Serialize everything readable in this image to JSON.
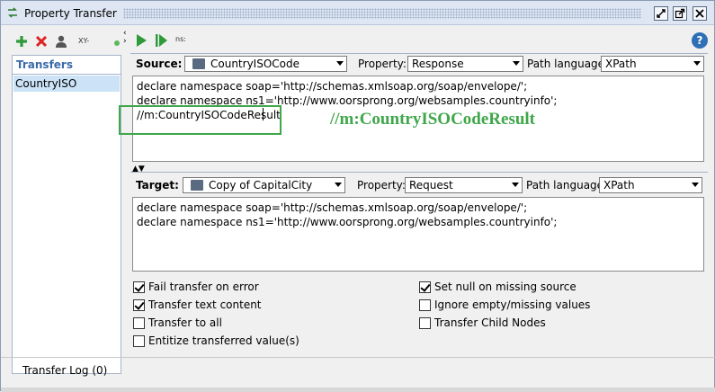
{
  "window": {
    "title": "Property Transfer",
    "buttons": [
      "restore-icon",
      "maximize-icon",
      "close-icon"
    ]
  },
  "left_toolbar": {
    "xy_label": "XY-"
  },
  "transfers": {
    "header": "Transfers",
    "items": [
      "CountryISO"
    ]
  },
  "right_toolbar": {
    "ns_label": "ns:"
  },
  "source": {
    "label": "Source:",
    "value": "CountryISOCode",
    "property_label": "Property:",
    "property_value": "Response",
    "path_language_label": "Path language:",
    "path_language_value": "XPath",
    "lines": [
      "declare namespace soap='http://schemas.xmlsoap.org/soap/envelope/';",
      "declare namespace ns1='http://www.oorsprong.org/websamples.countryinfo';",
      "//m:CountryISOCodeResult"
    ]
  },
  "annotation": "//m:CountryISOCodeResult",
  "target": {
    "label": "Target:",
    "value": "Copy of CapitalCity",
    "property_label": "Property:",
    "property_value": "Request",
    "path_language_label": "Path language:",
    "path_language_value": "XPath",
    "lines": [
      "declare namespace soap='http://schemas.xmlsoap.org/soap/envelope/';",
      "declare namespace ns1='http://www.oorsprong.org/websamples.countryinfo';"
    ]
  },
  "options": [
    {
      "label": "Fail transfer on error",
      "checked": true
    },
    {
      "label": "Transfer text content",
      "checked": true
    },
    {
      "label": "Transfer to all",
      "checked": false
    },
    {
      "label": "Entitize transferred value(s)",
      "checked": false
    },
    {
      "label": "Set null on missing source",
      "checked": true
    },
    {
      "label": "Ignore empty/missing values",
      "checked": false
    },
    {
      "label": "Transfer Child Nodes",
      "checked": false
    }
  ],
  "bottom": {
    "transfer_log": "Transfer Log (0)"
  },
  "colors": {
    "accent_green": "#3fa64a",
    "selection": "#cce3f7",
    "header_blue": "#3b6aa8"
  }
}
